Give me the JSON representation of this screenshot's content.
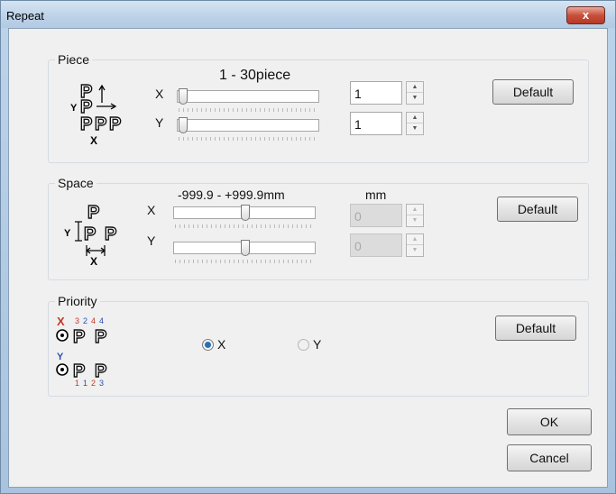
{
  "window": {
    "title": "Repeat",
    "close_label": "x"
  },
  "piece": {
    "group_title": "Piece",
    "range_label": "1 - 30piece",
    "x_label": "X",
    "y_label": "Y",
    "x_value": "1",
    "y_value": "1",
    "x_slider_fraction": 0,
    "y_slider_fraction": 0,
    "default_label": "Default",
    "icon": "piece-layout-icon",
    "icon_text": {
      "y": "Y",
      "x": "X",
      "p": "P"
    }
  },
  "space": {
    "group_title": "Space",
    "range_label": "-999.9 - +999.9mm",
    "unit_label": "mm",
    "x_label": "X",
    "y_label": "Y",
    "x_value": "0",
    "y_value": "0",
    "x_slider_fraction": 0.5,
    "y_slider_fraction": 0.5,
    "default_label": "Default",
    "icon": "spacing-layout-icon",
    "icon_text": {
      "y": "Y",
      "x": "X",
      "p": "P"
    }
  },
  "priority": {
    "group_title": "Priority",
    "option_x": "X",
    "option_y": "Y",
    "selected": "X",
    "default_label": "Default",
    "icon": "priority-order-icon",
    "icon_text": {
      "p": "P",
      "x_mark": "X",
      "y_mark": "Y",
      "top_numbers": [
        "3",
        "2",
        "4",
        "4"
      ],
      "bottom_numbers": [
        "1",
        "1",
        "2",
        "3"
      ]
    }
  },
  "footer": {
    "ok_label": "OK",
    "cancel_label": "Cancel"
  },
  "colors": {
    "accent_red": "#c0392b",
    "accent_blue": "#2a4fb5",
    "radio_selected": "#2a6fb5"
  }
}
